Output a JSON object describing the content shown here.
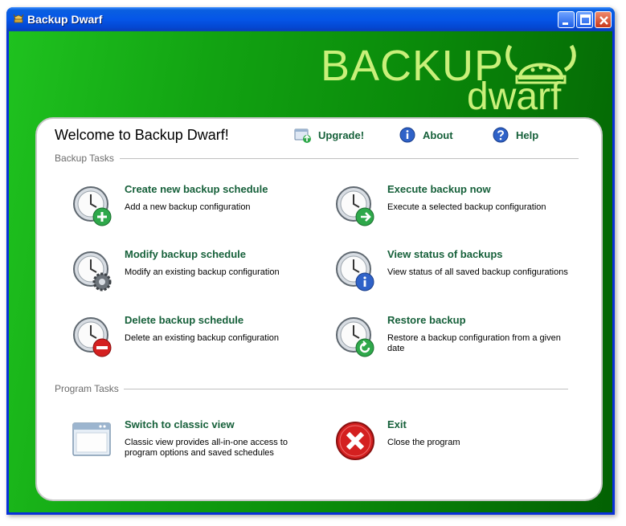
{
  "window": {
    "title": "Backup Dwarf"
  },
  "logo": {
    "line1": "BACKUP",
    "line2": "dwarf"
  },
  "header": {
    "welcome": "Welcome to Backup Dwarf!",
    "upgrade_label": "Upgrade!",
    "about_label": "About",
    "help_label": "Help"
  },
  "backup_tasks": {
    "section_label": "Backup Tasks",
    "items": [
      {
        "title": "Create new backup schedule",
        "desc": "Add a new backup configuration",
        "icon": "clock-add-icon"
      },
      {
        "title": "Execute backup now",
        "desc": "Execute a selected backup configuration",
        "icon": "clock-run-icon"
      },
      {
        "title": "Modify backup schedule",
        "desc": "Modify an existing backup configuration",
        "icon": "clock-gear-icon"
      },
      {
        "title": "View status of backups",
        "desc": "View status of all saved backup configurations",
        "icon": "clock-info-icon"
      },
      {
        "title": "Delete backup schedule",
        "desc": "Delete an existing backup configuration",
        "icon": "clock-delete-icon"
      },
      {
        "title": "Restore backup",
        "desc": "Restore a backup configuration from a given date",
        "icon": "clock-restore-icon"
      }
    ]
  },
  "program_tasks": {
    "section_label": "Program Tasks",
    "items": [
      {
        "title": "Switch to classic view",
        "desc": "Classic view provides all-in-one access to program options and saved schedules",
        "icon": "window-icon"
      },
      {
        "title": "Exit",
        "desc": "Close the program",
        "icon": "exit-icon"
      }
    ]
  },
  "colors": {
    "link": "#16603a",
    "accent": "#c9f07a",
    "bg_green": "#0a8a0a"
  }
}
